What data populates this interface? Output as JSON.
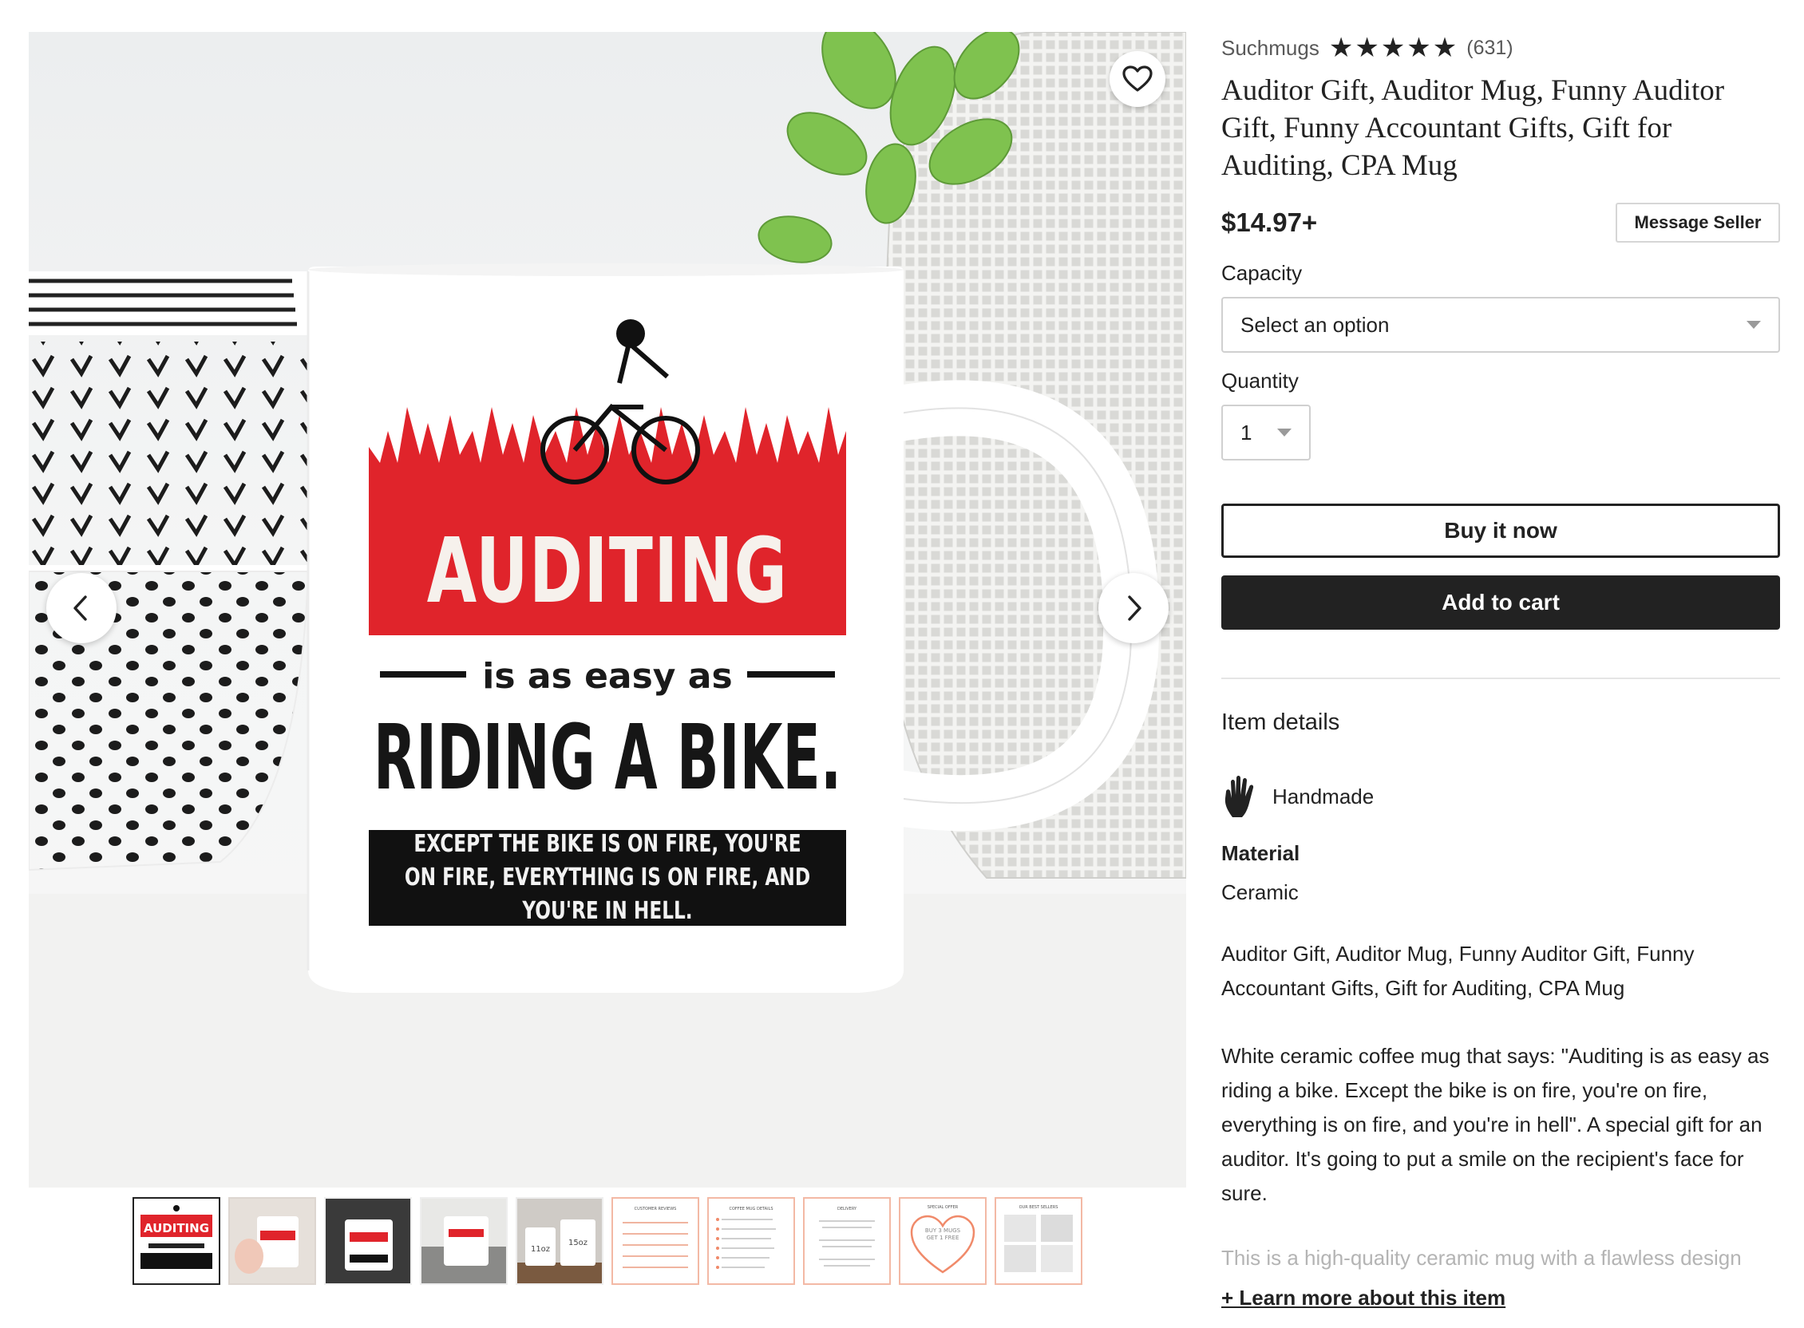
{
  "gallery": {
    "mug": {
      "line1": "AUDITING",
      "line2": "is as easy as",
      "line3": "RIDING A BIKE.",
      "line4": "EXCEPT THE BIKE IS ON FIRE, YOU'RE ON FIRE, EVERYTHING IS ON FIRE, AND YOU'RE IN HELL."
    },
    "favorite_icon": "heart-outline-icon",
    "prev_icon": "chevron-left-icon",
    "next_icon": "chevron-right-icon",
    "thumbnails": [
      {
        "kind": "photo",
        "caption": "AUDITING"
      },
      {
        "kind": "photo"
      },
      {
        "kind": "photo"
      },
      {
        "kind": "photo"
      },
      {
        "kind": "photo",
        "labels": [
          "11oz",
          "15oz"
        ]
      },
      {
        "kind": "doc",
        "heading": "CUSTOMER REVIEWS"
      },
      {
        "kind": "doc",
        "heading": "COFFEE MUG DETAILS"
      },
      {
        "kind": "doc",
        "heading": "DELIVERY"
      },
      {
        "kind": "doc",
        "heading": "SPECIAL OFFER",
        "offer": "BUY 3 MUGS GET 1 FREE"
      },
      {
        "kind": "doc",
        "heading": "OUR BEST SELLERS"
      }
    ]
  },
  "listing": {
    "seller": "Suchmugs",
    "rating": 5,
    "review_count": "(631)",
    "title": "Auditor Gift, Auditor Mug, Funny Auditor Gift, Funny Accountant Gifts, Gift for Auditing, CPA Mug",
    "price": "$14.97+",
    "message_seller": "Message Seller",
    "capacity_label": "Capacity",
    "capacity_value": "Select an option",
    "quantity_label": "Quantity",
    "quantity_value": "1",
    "buy_now": "Buy it now",
    "add_to_cart": "Add to cart"
  },
  "details": {
    "section_title": "Item details",
    "handmade": "Handmade",
    "handmade_icon": "hand-icon",
    "material_title": "Material",
    "material_value": "Ceramic",
    "description_1": "Auditor Gift, Auditor Mug, Funny Auditor Gift, Funny Accountant Gifts, Gift for Auditing, CPA Mug",
    "description_2": "White ceramic coffee mug that says: \"Auditing is as easy as riding a bike. Except the bike is on fire, you're on fire, everything is on fire, and you're in hell\". A special gift for an auditor. It's going to put a smile on the recipient's face for sure.",
    "description_3": "This is a high-quality ceramic mug with a flawless design",
    "learn_more": "+ Learn more about this item"
  },
  "colors": {
    "text": "#222222",
    "muted": "#595959",
    "mug_red": "#e0242b",
    "plant_green": "#7fc24f"
  }
}
